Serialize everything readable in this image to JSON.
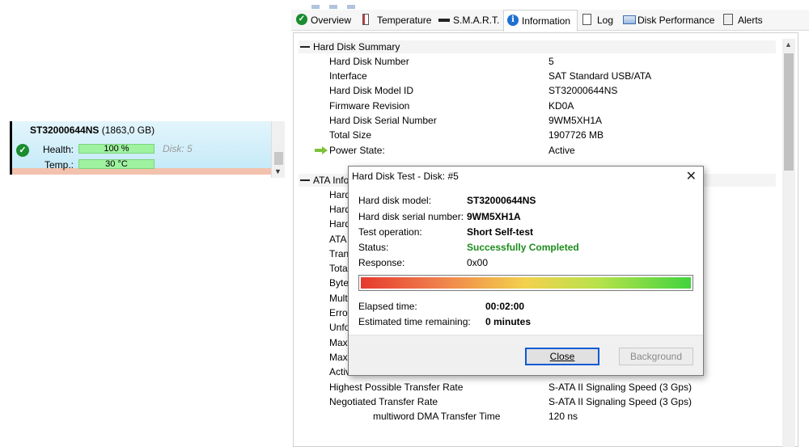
{
  "disk_panel": {
    "model": "ST32000644NS",
    "size": "(1863,0 GB)",
    "health_label": "Health:",
    "health_value": "100 %",
    "temp_label": "Temp.:",
    "temp_value": "30 °C",
    "disk_number": "Disk: 5"
  },
  "tabs": [
    {
      "label": "Overview",
      "icon": "check-circle-icon"
    },
    {
      "label": "Temperature",
      "icon": "thermometer-icon"
    },
    {
      "label": "S.M.A.R.T.",
      "icon": "dash-icon"
    },
    {
      "label": "Information",
      "icon": "info-icon"
    },
    {
      "label": "Log",
      "icon": "document-icon"
    },
    {
      "label": "Disk Performance",
      "icon": "performance-chart-icon"
    },
    {
      "label": "Alerts",
      "icon": "alerts-document-icon"
    }
  ],
  "summary": {
    "heading": "Hard Disk Summary",
    "rows": [
      {
        "label": "Hard Disk Number",
        "value": "5"
      },
      {
        "label": "Interface",
        "value": "SAT Standard USB/ATA"
      },
      {
        "label": "Hard Disk Model ID",
        "value": "ST32000644NS"
      },
      {
        "label": "Firmware Revision",
        "value": "KD0A"
      },
      {
        "label": "Hard Disk Serial Number",
        "value": "9WM5XH1A"
      },
      {
        "label": "Total Size",
        "value": "1907726 MB"
      },
      {
        "label": "Power State:",
        "value": "Active"
      }
    ]
  },
  "ata": {
    "heading": "ATA Info",
    "partial_rows": [
      "Hard",
      "Hard",
      "Hard",
      "ATA",
      "Trans",
      "Total",
      "Byte",
      "Multi",
      "Error",
      "Unfo",
      "Maxi",
      "Maxi",
      "Activ"
    ],
    "rows": [
      {
        "label": "Highest Possible Transfer Rate",
        "value": "S-ATA II Signaling Speed (3 Gps)"
      },
      {
        "label": "Negotiated Transfer Rate",
        "value": "S-ATA II Signaling Speed (3 Gps)"
      },
      {
        "label": "multiword DMA Transfer Time",
        "value": "120 ns"
      }
    ]
  },
  "dialog": {
    "title": "Hard Disk Test - Disk: #5",
    "model_label": "Hard disk model:",
    "model_value": "ST32000644NS",
    "serial_label": "Hard disk serial number:",
    "serial_value": "9WM5XH1A",
    "operation_label": "Test operation:",
    "operation_value": "Short Self-test",
    "status_label": "Status:",
    "status_value": "Successfully Completed",
    "response_label": "Response:",
    "response_value": "0x00",
    "progress_percent": 100,
    "elapsed_label": "Elapsed time:",
    "elapsed_value": "00:02:00",
    "remaining_label": "Estimated time remaining:",
    "remaining_value": "0 minutes",
    "close_button": "Close",
    "background_button": "Background"
  }
}
